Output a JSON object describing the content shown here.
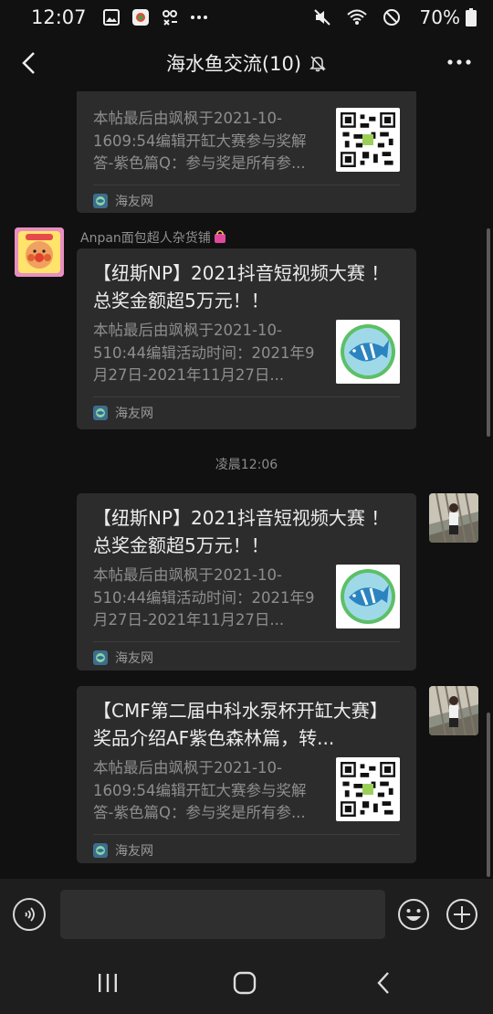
{
  "status_bar": {
    "time": "12:07",
    "battery": "70%",
    "icons": [
      "gallery-icon",
      "app-icon",
      "tool-icon",
      "more-dots-icon",
      "mute-icon",
      "wifi-icon",
      "no-disturb-icon",
      "battery-icon"
    ]
  },
  "header": {
    "title": "海水鱼交流(10)",
    "icons": [
      "back-arrow-icon",
      "muted-bell-icon",
      "more-options-icon"
    ]
  },
  "messages": [
    {
      "direction": "incoming",
      "title": "",
      "description": "本帖最后由飒枫于2021-10-1609:54编辑开缸大赛参与奖解答-紫色篇Q：参与奖是所有参...",
      "source": "海友网",
      "thumbnail": "qr-code"
    },
    {
      "direction": "incoming",
      "sender": "Anpan面包超人杂货铺",
      "title": "【纽斯NP】2021抖音短视频大赛 ！总奖金额超5万元！！",
      "description": "本帖最后由飒枫于2021-10-510:44编辑活动时间：2021年9月27日-2021年11月27日...",
      "source": "海友网",
      "thumbnail": "fish-logo"
    },
    {
      "type": "timestamp",
      "text": "凌晨12:06"
    },
    {
      "direction": "outgoing",
      "title": "【纽斯NP】2021抖音短视频大赛 ！总奖金额超5万元！！",
      "description": "本帖最后由飒枫于2021-10-510:44编辑活动时间：2021年9月27日-2021年11月27日...",
      "source": "海友网",
      "thumbnail": "fish-logo"
    },
    {
      "direction": "outgoing",
      "title": "【CMF第二届中科水泵杯开缸大赛】奖品介绍AF紫色森林篇，转...",
      "description": "本帖最后由飒枫于2021-10-1609:54编辑开缸大赛参与奖解答-紫色篇Q：参与奖是所有参...",
      "source": "海友网",
      "thumbnail": "qr-code"
    }
  ],
  "input_bar": {
    "value": "",
    "icons": [
      "voice-icon",
      "emoji-icon",
      "plus-icon"
    ]
  },
  "nav_bar": {
    "icons": [
      "recent-apps-icon",
      "home-icon",
      "back-icon"
    ]
  },
  "colors": {
    "background": "#111111",
    "card": "#2c2c2c",
    "input_bar": "#1e1e1e"
  }
}
